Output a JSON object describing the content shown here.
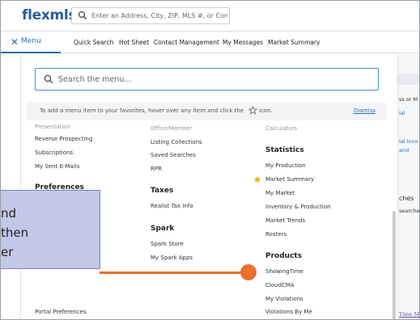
{
  "header": {
    "logo": "flexmls",
    "search_placeholder": "Enter an Address, City, ZIP, MLS #, or Contact..."
  },
  "nav": {
    "menu_label": "Menu",
    "links": [
      "Quick Search",
      "Hot Sheet",
      "Contact Management",
      "My Messages",
      "Market Summary"
    ]
  },
  "background_right": {
    "text1": "ss or M",
    "text2": "ial",
    "text3": "ial Inco",
    "text4": "and",
    "text5": "ches",
    "text6": "searche",
    "text7": "Time M"
  },
  "menu_panel": {
    "search_placeholder": "Search the menu...",
    "favorites_tip": "To add a menu item to your favorites, hover over any item and click the",
    "favorites_tip_end": "icon.",
    "dismiss_label": "Dismiss",
    "col1": {
      "faded_item": "Presentation",
      "items_top": [
        "Reverse Prospecting",
        "Subscriptions",
        "My Sent E-Mails"
      ],
      "heading_preferences": "Preferences",
      "item_bottom": "Portal Preferences"
    },
    "col2": {
      "faded_item": "Office/Member",
      "items_top": [
        "Listing Collections",
        "Saved Searches",
        "RPR"
      ],
      "heading_taxes": "Taxes",
      "taxes_items": [
        "Realist Tax Info"
      ],
      "heading_spark": "Spark",
      "spark_items": [
        "Spark Store",
        "My Spark Apps"
      ]
    },
    "col3": {
      "faded_item": "Calculators",
      "heading_statistics": "Statistics",
      "statistics_items": [
        "My Production",
        "Market Summary",
        "My Market",
        "Inventory & Production",
        "Market Trends",
        "Rosters"
      ],
      "heading_products": "Products",
      "products_items": [
        "ShowingTime",
        "CloudCMA",
        "My Violations",
        "Violations By Me"
      ]
    }
  },
  "callout": {
    "lines": [
      "nd",
      "then",
      "er"
    ]
  },
  "colors": {
    "brand": "#2a5f97",
    "accent": "#2a6fb0",
    "highlight": "#e8702a",
    "favorite_star": "#f2b01e",
    "callout_bg": "#c3c8e8"
  }
}
